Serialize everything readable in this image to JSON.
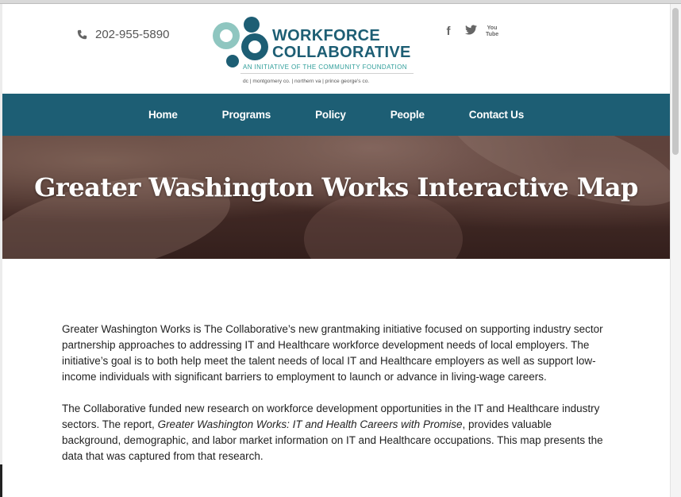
{
  "header": {
    "phone": "202-955-5890",
    "logo": {
      "line1": "WORKFORCE",
      "line2": "COLLABORATIVE",
      "tagline": "AN INITIATIVE OF THE COMMUNITY FOUNDATION",
      "areas": "dc  |  montgomery co.  |  northern va  |  prince george's co."
    },
    "social": [
      {
        "icon": "facebook-icon",
        "glyph": "f"
      },
      {
        "icon": "twitter-icon",
        "glyph": "t"
      },
      {
        "icon": "youtube-icon",
        "glyph": "You Tube"
      }
    ]
  },
  "nav": {
    "items": [
      "Home",
      "Programs",
      "Policy",
      "People",
      "Contact Us"
    ]
  },
  "hero": {
    "title": "Greater Washington Works Interactive Map"
  },
  "content": {
    "p1": "Greater Washington Works is The Collaborative’s new grantmaking initiative focused on supporting industry sector partnership approaches to addressing IT and Healthcare workforce development needs of local employers. The initiative’s goal is to both help meet the talent needs of local IT and Healthcare employers as well as support low-income individuals with significant barriers to employment to launch or advance in living-wage careers.",
    "p2_before": "The Collaborative funded new research on workforce development opportunities in the IT and Healthcare industry sectors. The report, ",
    "p2_italic": "Greater Washington Works: IT and Health Careers with Promise",
    "p2_after": ", provides valuable background, demographic, and labor market information on IT and Healthcare occupations. This map presents the data that was captured from that research."
  },
  "colors": {
    "brand_teal": "#1d5e74",
    "accent_aqua": "#2f9e9a"
  }
}
